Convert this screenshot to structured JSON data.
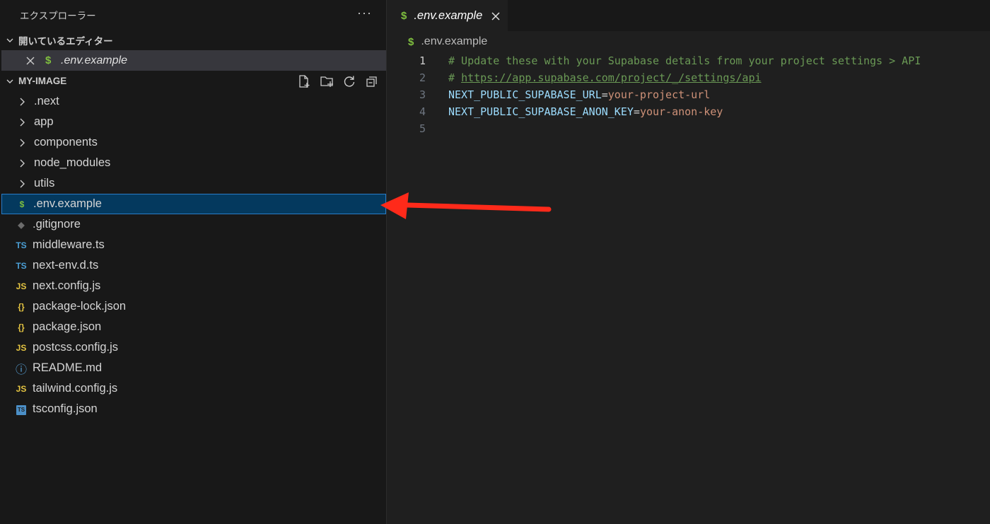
{
  "explorer": {
    "title": "エクスプローラー",
    "more": "···"
  },
  "open_editors": {
    "header": "開いているエディター",
    "items": [
      {
        "icon": "$",
        "name": ".env.example"
      }
    ]
  },
  "project": {
    "name": "MY-IMAGE",
    "folders": [
      ".next",
      "app",
      "components",
      "node_modules",
      "utils"
    ],
    "files": [
      {
        "icon": "$",
        "kind": "env",
        "name": ".env.example",
        "selected": true
      },
      {
        "icon": "◆",
        "kind": "git",
        "name": ".gitignore"
      },
      {
        "icon": "TS",
        "kind": "ts",
        "name": "middleware.ts"
      },
      {
        "icon": "TS",
        "kind": "ts",
        "name": "next-env.d.ts"
      },
      {
        "icon": "JS",
        "kind": "js",
        "name": "next.config.js"
      },
      {
        "icon": "{}",
        "kind": "json",
        "name": "package-lock.json"
      },
      {
        "icon": "{}",
        "kind": "json",
        "name": "package.json"
      },
      {
        "icon": "JS",
        "kind": "js",
        "name": "postcss.config.js"
      },
      {
        "icon": "ⓘ",
        "kind": "info",
        "name": "README.md"
      },
      {
        "icon": "JS",
        "kind": "js",
        "name": "tailwind.config.js"
      },
      {
        "icon": "TS",
        "kind": "tsconfig",
        "name": "tsconfig.json"
      }
    ]
  },
  "editor": {
    "tab": {
      "icon": "$",
      "name": ".env.example"
    },
    "breadcrumb": {
      "icon": "$",
      "name": ".env.example"
    },
    "lines": [
      {
        "num": "1",
        "comment": "# Update these with your Supabase details from your project settings > API"
      },
      {
        "num": "2",
        "comment_prefix": "# ",
        "link": "https://app.supabase.com/project/_/settings/api"
      },
      {
        "num": "3",
        "key": "NEXT_PUBLIC_SUPABASE_URL",
        "eq": "=",
        "value": "your-project-url"
      },
      {
        "num": "4",
        "key": "NEXT_PUBLIC_SUPABASE_ANON_KEY",
        "eq": "=",
        "value": "your-anon-key"
      },
      {
        "num": "5"
      }
    ]
  },
  "colors": {
    "accent_selected": "#04395e",
    "annotation_arrow": "#ff2a1a",
    "env_icon": "#7fbf3f"
  }
}
